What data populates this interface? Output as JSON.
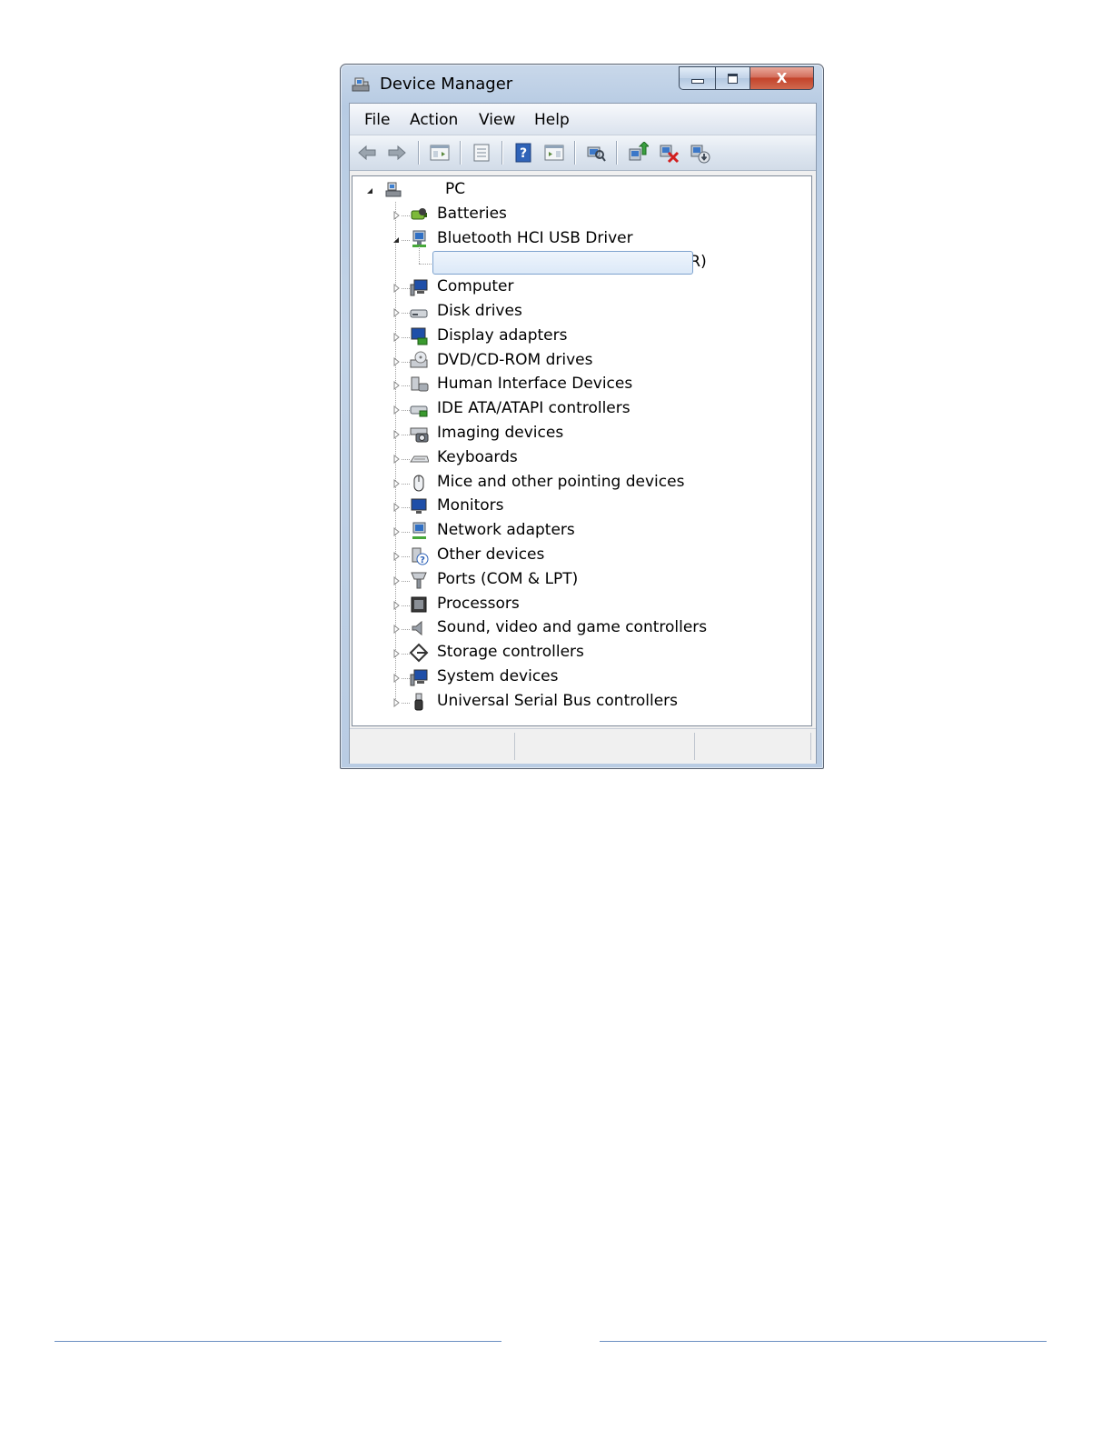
{
  "window": {
    "title": "Device Manager",
    "close_glyph": "X"
  },
  "menu": [
    "File",
    "Action",
    "View",
    "Help"
  ],
  "toolbar": [
    "back-icon",
    "forward-icon",
    "show-hide-tree-icon",
    "properties-icon",
    "help-icon",
    "action-pane-icon",
    "scan-hardware-icon",
    "update-driver-icon",
    "uninstall-icon",
    "disable-icon"
  ],
  "tree": {
    "root": "PC",
    "categories": [
      {
        "label": "Batteries",
        "icon": "battery-icon",
        "expanded": false
      },
      {
        "label": "Bluetooth HCI USB Driver",
        "icon": "bluetooth-network-icon",
        "expanded": true,
        "children": [
          {
            "label": "Bluetooth HCI USB Driver (CSR)",
            "icon": "bluetooth-device-icon",
            "selected": true
          }
        ]
      },
      {
        "label": "Computer",
        "icon": "computer-icon",
        "expanded": false
      },
      {
        "label": "Disk drives",
        "icon": "disk-drive-icon",
        "expanded": false
      },
      {
        "label": "Display adapters",
        "icon": "display-adapter-icon",
        "expanded": false
      },
      {
        "label": "DVD/CD-ROM drives",
        "icon": "dvd-drive-icon",
        "expanded": false
      },
      {
        "label": "Human Interface Devices",
        "icon": "hid-icon",
        "expanded": false
      },
      {
        "label": "IDE ATA/ATAPI controllers",
        "icon": "ide-controller-icon",
        "expanded": false
      },
      {
        "label": "Imaging devices",
        "icon": "camera-icon",
        "expanded": false
      },
      {
        "label": "Keyboards",
        "icon": "keyboard-icon",
        "expanded": false
      },
      {
        "label": "Mice and other pointing devices",
        "icon": "mouse-icon",
        "expanded": false
      },
      {
        "label": "Monitors",
        "icon": "monitor-icon",
        "expanded": false
      },
      {
        "label": "Network adapters",
        "icon": "network-adapter-icon",
        "expanded": false
      },
      {
        "label": "Other devices",
        "icon": "unknown-device-icon",
        "expanded": false
      },
      {
        "label": "Ports (COM & LPT)",
        "icon": "port-icon",
        "expanded": false
      },
      {
        "label": "Processors",
        "icon": "processor-icon",
        "expanded": false
      },
      {
        "label": "Sound, video and game controllers",
        "icon": "speaker-icon",
        "expanded": false
      },
      {
        "label": "Storage controllers",
        "icon": "storage-controller-icon",
        "expanded": false
      },
      {
        "label": "System devices",
        "icon": "system-device-icon",
        "expanded": false
      },
      {
        "label": "Universal Serial Bus controllers",
        "icon": "usb-icon",
        "expanded": false
      }
    ]
  },
  "colors": {
    "selection_border": "#7da2ce",
    "footer_rule": "#6b8fc2"
  }
}
